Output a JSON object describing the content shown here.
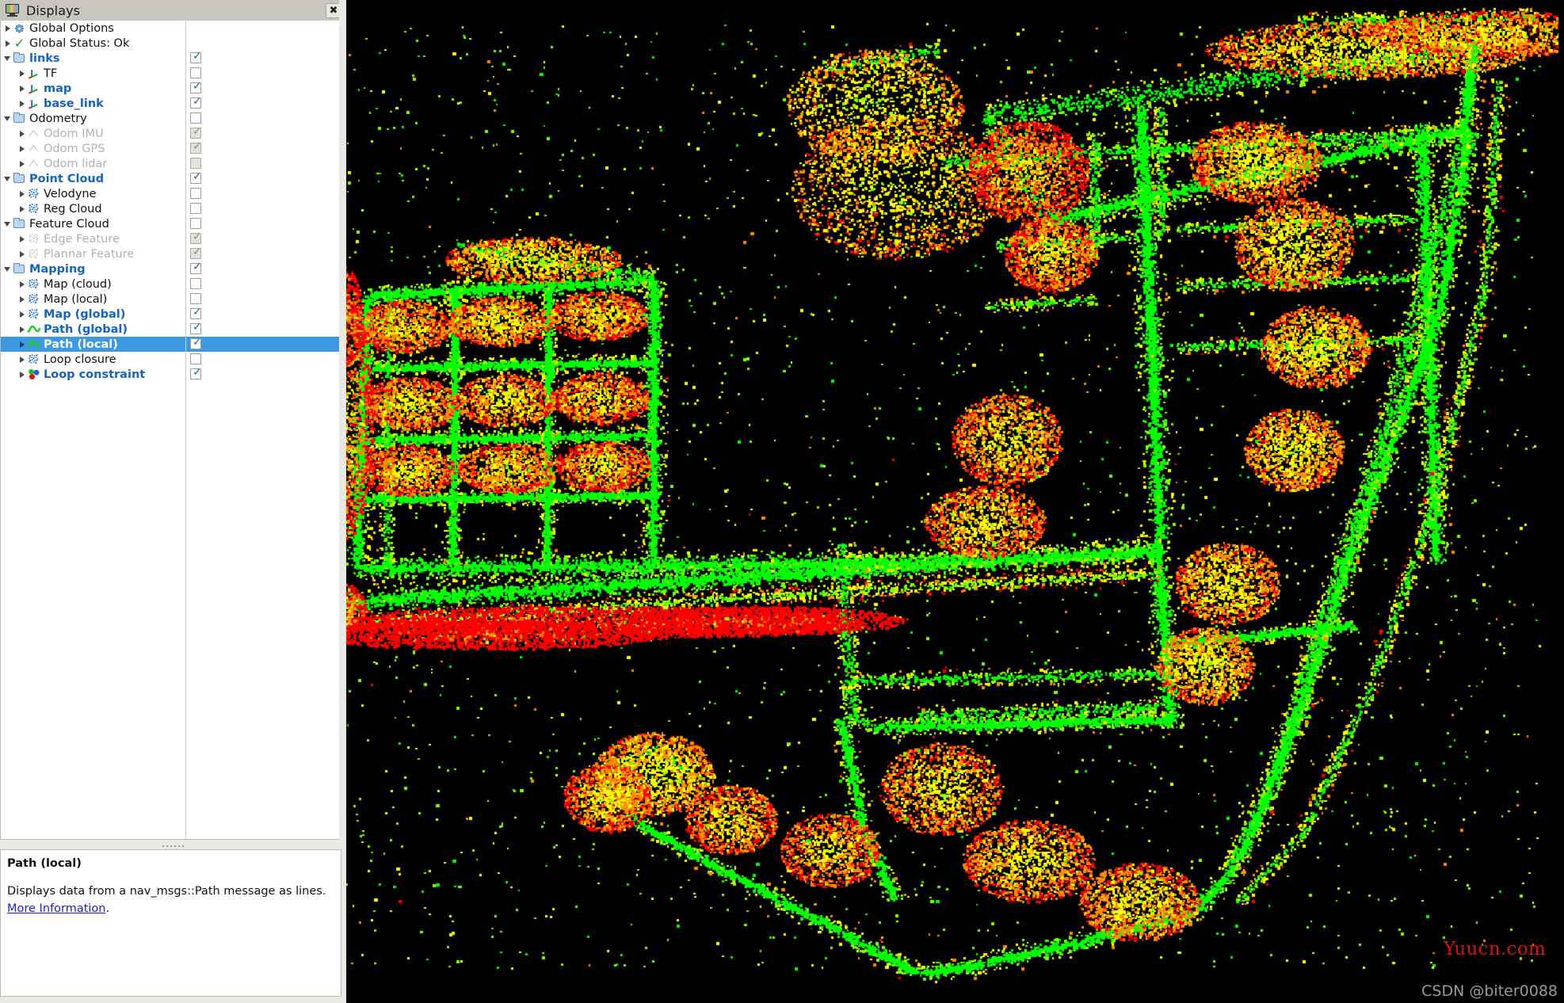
{
  "window": {
    "title": "Displays",
    "icon": "monitor-icon",
    "close_label": "✖"
  },
  "tree": {
    "items": [
      {
        "label": "Global Options",
        "icon": "gear-icon",
        "indent": 0,
        "twist": "closed",
        "style": "normal",
        "checkbox": "none"
      },
      {
        "label": "Global Status: Ok",
        "icon": "check-icon",
        "indent": 0,
        "twist": "closed",
        "style": "normal",
        "checkbox": "none"
      },
      {
        "label": "links",
        "icon": "folder-icon",
        "indent": 0,
        "twist": "open",
        "style": "blue",
        "checkbox": "checked"
      },
      {
        "label": "TF",
        "icon": "tf-axes-icon",
        "indent": 1,
        "twist": "closed",
        "style": "normal",
        "checkbox": "unchecked"
      },
      {
        "label": "map",
        "icon": "tf-axes-icon",
        "indent": 1,
        "twist": "closed",
        "style": "blue",
        "checkbox": "checked"
      },
      {
        "label": "base_link",
        "icon": "tf-axes-icon",
        "indent": 1,
        "twist": "closed",
        "style": "blue",
        "checkbox": "checked"
      },
      {
        "label": "Odometry",
        "icon": "folder-icon",
        "indent": 0,
        "twist": "open",
        "style": "normal",
        "checkbox": "unchecked"
      },
      {
        "label": "Odom IMU",
        "icon": "odometry-icon",
        "indent": 1,
        "twist": "closed",
        "style": "disabled",
        "checkbox": "disabled-checked"
      },
      {
        "label": "Odom GPS",
        "icon": "odometry-icon",
        "indent": 1,
        "twist": "closed",
        "style": "disabled",
        "checkbox": "disabled-checked"
      },
      {
        "label": "Odom lidar",
        "icon": "odometry-icon",
        "indent": 1,
        "twist": "closed",
        "style": "disabled",
        "checkbox": "disabled-unchecked"
      },
      {
        "label": "Point Cloud",
        "icon": "folder-icon",
        "indent": 0,
        "twist": "open",
        "style": "blue",
        "checkbox": "checked"
      },
      {
        "label": "Velodyne",
        "icon": "pointcloud-icon",
        "indent": 1,
        "twist": "closed",
        "style": "normal",
        "checkbox": "unchecked"
      },
      {
        "label": "Reg Cloud",
        "icon": "pointcloud-icon",
        "indent": 1,
        "twist": "closed",
        "style": "normal",
        "checkbox": "unchecked"
      },
      {
        "label": "Feature Cloud",
        "icon": "folder-icon",
        "indent": 0,
        "twist": "open",
        "style": "normal",
        "checkbox": "unchecked"
      },
      {
        "label": "Edge Feature",
        "icon": "pointcloud-icon",
        "indent": 1,
        "twist": "closed",
        "style": "disabled",
        "checkbox": "disabled-checked"
      },
      {
        "label": "Plannar Feature",
        "icon": "pointcloud-icon",
        "indent": 1,
        "twist": "closed",
        "style": "disabled",
        "checkbox": "disabled-checked"
      },
      {
        "label": "Mapping",
        "icon": "folder-icon",
        "indent": 0,
        "twist": "open",
        "style": "blue",
        "checkbox": "checked"
      },
      {
        "label": "Map (cloud)",
        "icon": "pointcloud-icon",
        "indent": 1,
        "twist": "closed",
        "style": "normal",
        "checkbox": "unchecked"
      },
      {
        "label": "Map (local)",
        "icon": "pointcloud-icon",
        "indent": 1,
        "twist": "closed",
        "style": "normal",
        "checkbox": "unchecked"
      },
      {
        "label": "Map (global)",
        "icon": "pointcloud-icon",
        "indent": 1,
        "twist": "closed",
        "style": "blue",
        "checkbox": "checked"
      },
      {
        "label": "Path (global)",
        "icon": "path-icon",
        "indent": 1,
        "twist": "closed",
        "style": "blue",
        "checkbox": "checked"
      },
      {
        "label": "Path (local)",
        "icon": "path-icon",
        "indent": 1,
        "twist": "closed",
        "style": "selected",
        "checkbox": "checked"
      },
      {
        "label": "Loop closure",
        "icon": "pointcloud-icon",
        "indent": 1,
        "twist": "closed",
        "style": "normal",
        "checkbox": "unchecked"
      },
      {
        "label": "Loop constraint",
        "icon": "markerarray-icon",
        "indent": 1,
        "twist": "closed",
        "style": "blue",
        "checkbox": "checked"
      }
    ]
  },
  "description": {
    "title": "Path (local)",
    "text_before": "Displays data from a nav_msgs::Path message as lines. ",
    "link": "More Information",
    "text_after": "."
  },
  "viewport": {
    "background": "#000000",
    "cloud_colors": [
      "#00ff00",
      "#7fff00",
      "#ffff00",
      "#ff8c00",
      "#ff0000"
    ]
  },
  "watermarks": {
    "site": "Yuucn.com",
    "site_color": "#d51313",
    "csdn": "CSDN @biter0088",
    "csdn_color": "#9a9a9a"
  }
}
